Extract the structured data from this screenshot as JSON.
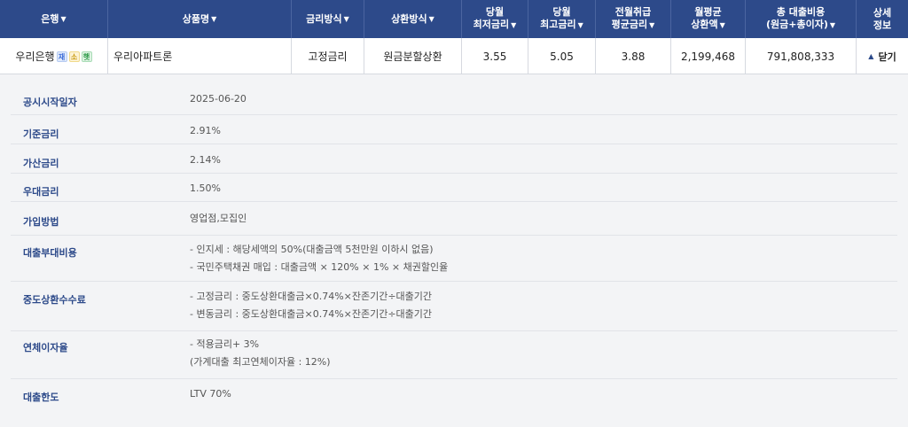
{
  "header": {
    "bank": "은행",
    "product": "상품명",
    "rate_type": "금리방식",
    "repay_type": "상환방식",
    "min_rate": [
      "당월",
      "최저금리"
    ],
    "max_rate": [
      "당월",
      "최고금리"
    ],
    "avg_rate": [
      "전월취급",
      "평균금리"
    ],
    "monthly": [
      "월평균",
      "상환액"
    ],
    "total": [
      "총 대출비용",
      "(원금+총이자)"
    ],
    "detail": [
      "상세",
      "정보"
    ]
  },
  "row": {
    "bank": "우리은행",
    "badges": [
      "재",
      "소",
      "햇"
    ],
    "product": "우리아파트론",
    "rate_type": "고정금리",
    "repay_type": "원금분할상환",
    "min_rate": "3.55",
    "max_rate": "5.05",
    "avg_rate": "3.88",
    "monthly": "2,199,468",
    "total": "791,808,333",
    "close_label": "닫기"
  },
  "details": [
    {
      "label": "공시시작일자",
      "lines": [
        "2025-06-20"
      ]
    },
    {
      "label": "기준금리",
      "lines": [
        "2.91%"
      ]
    },
    {
      "label": "가산금리",
      "lines": [
        "2.14%"
      ]
    },
    {
      "label": "우대금리",
      "lines": [
        "1.50%"
      ]
    },
    {
      "label": "가입방법",
      "lines": [
        "영업점,모집인"
      ]
    },
    {
      "label": "대출부대비용",
      "lines": [
        "- 인지세 : 해당세액의 50%(대출금액 5천만원 이하시 없음)",
        "- 국민주택채권 매입 : 대출금액 × 120% × 1% × 채권할인율"
      ]
    },
    {
      "label": "중도상환수수료",
      "lines": [
        "- 고정금리 : 중도상환대출금×0.74%×잔존기간÷대출기간",
        "- 변동금리 : 중도상환대출금×0.74%×잔존기간÷대출기간"
      ]
    },
    {
      "label": "연체이자율",
      "lines": [
        "- 적용금리+ 3%",
        "(가계대출 최고연체이자율 : 12%)"
      ]
    },
    {
      "label": "대출한도",
      "lines": [
        "LTV 70%"
      ]
    }
  ]
}
